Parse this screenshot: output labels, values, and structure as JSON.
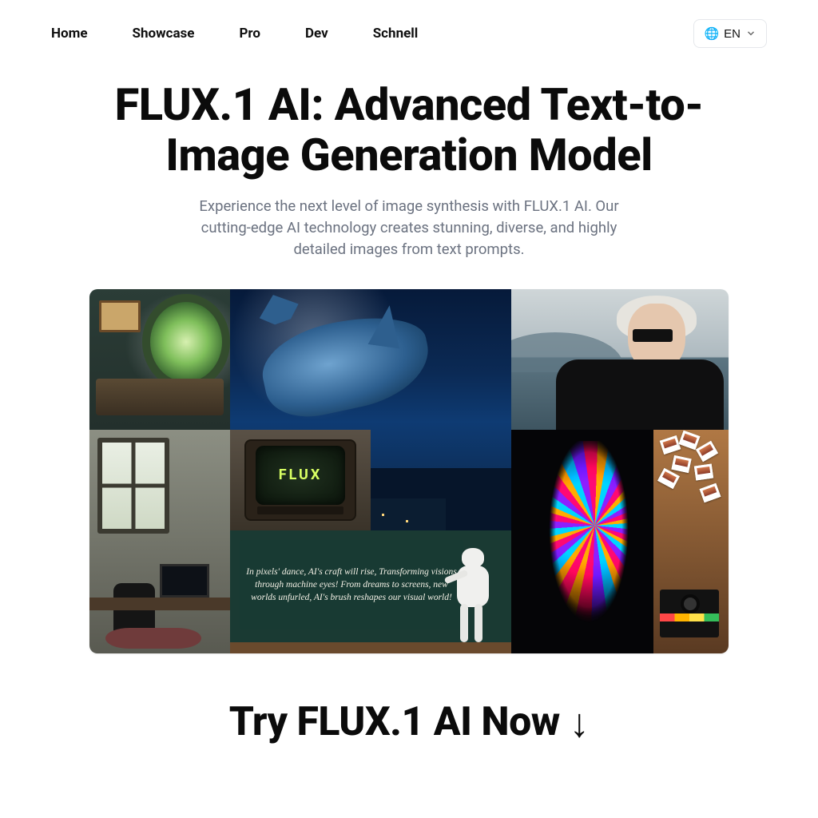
{
  "nav": {
    "items": [
      {
        "label": "Home"
      },
      {
        "label": "Showcase"
      },
      {
        "label": "Pro"
      },
      {
        "label": "Dev"
      },
      {
        "label": "Schnell"
      }
    ]
  },
  "language": {
    "flag": "🌐",
    "code": "EN"
  },
  "hero": {
    "title": "FLUX.1 AI: Advanced Text-to-Image Generation Model",
    "subtitle": "Experience the next level of image synthesis with FLUX.1 AI. Our cutting-edge AI technology creates stunning, diverse, and highly detailed images from text prompts."
  },
  "gallery": {
    "tv_screen_text": "FLUX",
    "poem": "In pixels' dance, AI's craft will rise,\nTransforming visions through machine eyes!\nFrom dreams to screens, new worlds unfurled,\nAI's brush reshapes our visual world!"
  },
  "cta": {
    "label": "Try FLUX.1 AI Now",
    "arrow": "↓"
  }
}
